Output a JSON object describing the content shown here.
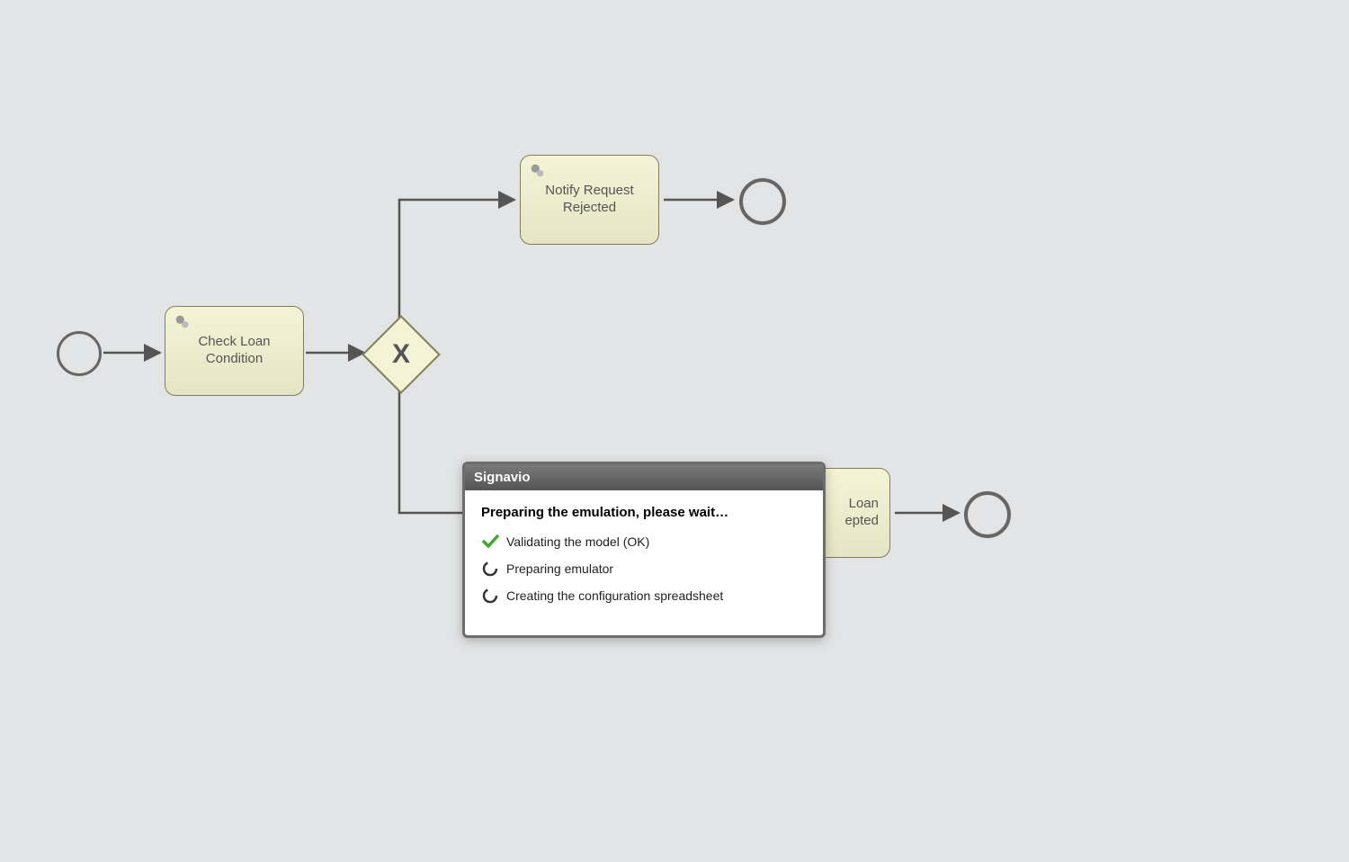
{
  "diagram": {
    "start_event": "",
    "task_check_loan": "Check Loan Condition",
    "gateway_label": "X",
    "task_notify_rejected": "Notify Request Rejected",
    "task_notify_accepted_visible": "Loan\nepted",
    "end_event_top": "",
    "end_event_bottom": ""
  },
  "dialog": {
    "title": "Signavio",
    "heading": "Preparing the emulation, please wait…",
    "steps": [
      {
        "status": "ok",
        "label": "Validating the model (OK)"
      },
      {
        "status": "spin",
        "label": "Preparing emulator"
      },
      {
        "status": "spin",
        "label": "Creating the configuration spreadsheet"
      }
    ]
  }
}
